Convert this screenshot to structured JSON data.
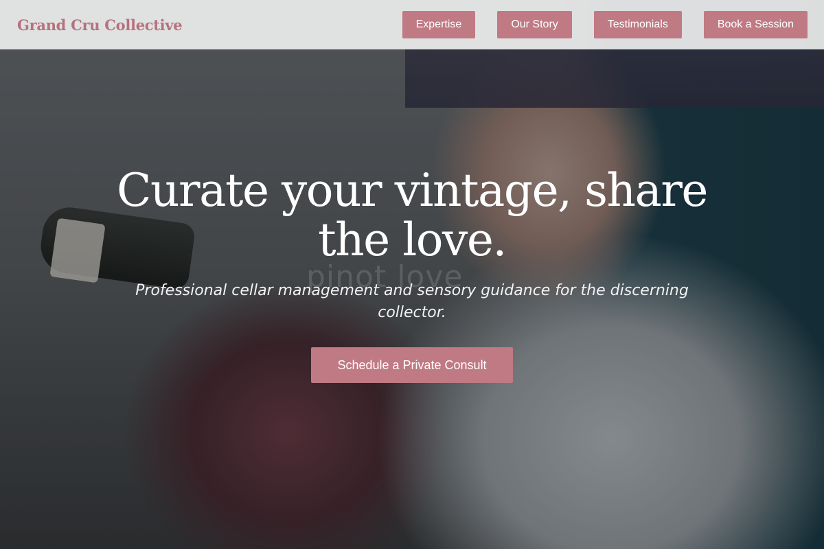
{
  "brand": {
    "name": "Grand Cru Collective"
  },
  "nav": {
    "items": [
      {
        "label": "Expertise"
      },
      {
        "label": "Our Story"
      },
      {
        "label": "Testimonials"
      },
      {
        "label": "Book a Session"
      }
    ]
  },
  "hero": {
    "headline": "Curate your vintage, share the love.",
    "subheadline": "Professional cellar management and sensory guidance for the discerning collector.",
    "cta_label": "Schedule a Private Consult",
    "watermark": "pinot love"
  },
  "colors": {
    "accent": "#c07a84",
    "brand_text": "#b5727e",
    "header_bg": "#ececec"
  }
}
